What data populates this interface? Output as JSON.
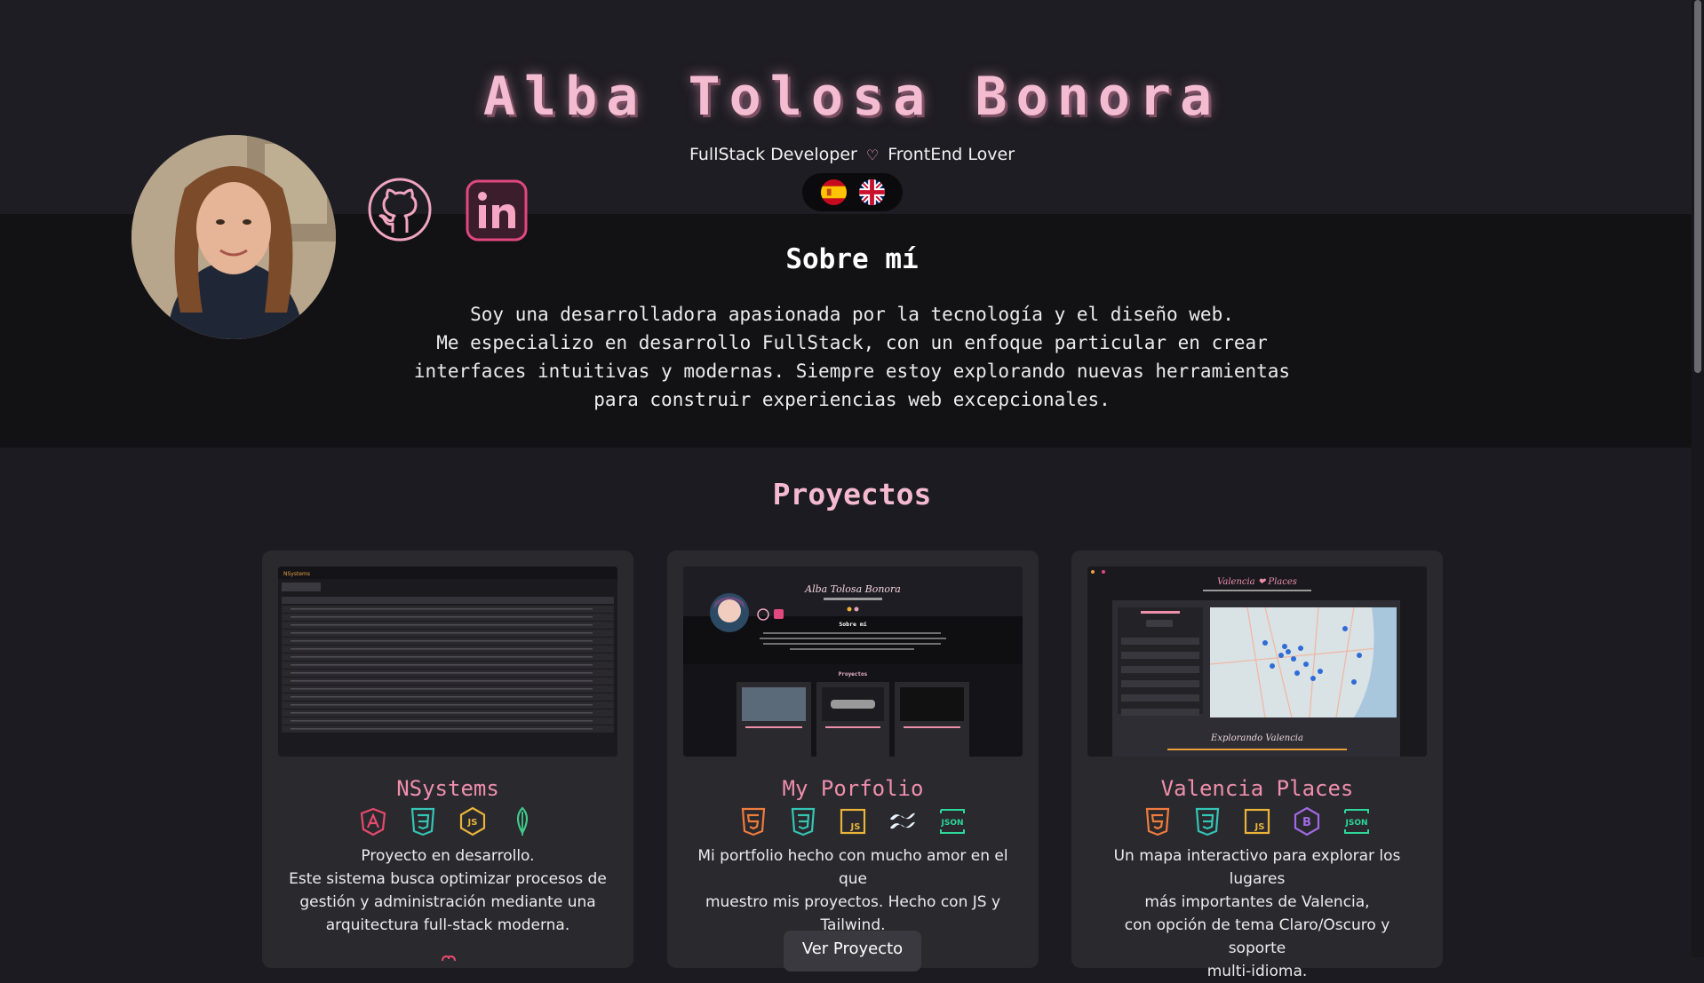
{
  "header": {
    "name": "Alba Tolosa Bonora",
    "role_1": "FullStack Developer",
    "heart": "♡",
    "role_2": "FrontEnd Lover"
  },
  "icons": {
    "github": "github-icon",
    "linkedin": "linkedin-icon",
    "flag_es": "spain-flag-icon",
    "flag_en": "uk-flag-icon"
  },
  "about": {
    "title": "Sobre mí",
    "line_1": "Soy una desarrolladora apasionada por la tecnología y el diseño web.",
    "line_2": "Me especializo en desarrollo FullStack, con un enfoque particular en crear",
    "line_3": "interfaces intuitivas y modernas. Siempre estoy explorando nuevas herramientas",
    "line_4": "para construir experiencias web excepcionales."
  },
  "projects": {
    "title": "Proyectos",
    "items": [
      {
        "title": "NSystems",
        "techs": [
          "angular-icon",
          "css3-icon",
          "nodejs-icon",
          "mongodb-icon"
        ],
        "desc_1": "Proyecto en desarrollo.",
        "desc_2": "Este sistema busca optimizar procesos de",
        "desc_3": "gestión y administración mediante una",
        "desc_4": "arquitectura full-stack moderna."
      },
      {
        "title": "My Porfolio",
        "techs": [
          "html5-icon",
          "css3-icon",
          "javascript-icon",
          "tailwind-icon",
          "json-icon"
        ],
        "desc_1": "Mi portfolio hecho con mucho amor en el que",
        "desc_2": "muestro mis proyectos. Hecho con JS y",
        "desc_3": "Tailwind.",
        "button": "Ver Proyecto"
      },
      {
        "title": "Valencia Places",
        "techs": [
          "html5-icon",
          "css3-icon",
          "javascript-icon",
          "bootstrap-icon",
          "json-icon"
        ],
        "desc_1": "Un mapa interactivo para explorar los lugares",
        "desc_2": "más importantes de Valencia,",
        "desc_3": "con opción de tema Claro/Oscuro y soporte",
        "desc_4": "multi-idioma."
      }
    ]
  },
  "thumbnails": {
    "nsystems_brand": "NSystems",
    "portfolio_name": "Alba Tolosa Bonora",
    "portfolio_about": "Sobre mí",
    "portfolio_projects": "Proyectos",
    "valencia_title": "Valencia ❤ Places",
    "valencia_footer": "Explorando Valencia"
  },
  "colors": {
    "accent_pink": "#f3bcd0",
    "card_title": "#ee8fab",
    "background": "#1c1b21",
    "about_band": "#121114"
  }
}
